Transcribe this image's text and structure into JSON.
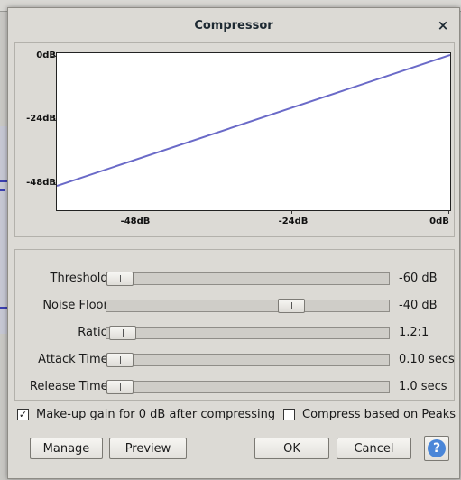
{
  "dialog": {
    "title": "Compressor",
    "close_glyph": "×"
  },
  "graph": {
    "y_labels": [
      "0dB",
      "-24dB",
      "-48dB"
    ],
    "x_labels": [
      "-48dB",
      "-24dB",
      "0dB"
    ],
    "curve_color": "#6a6ac8",
    "curve": [
      {
        "in_db": -60,
        "out_db": -48.3
      },
      {
        "in_db": 0,
        "out_db": 0
      }
    ]
  },
  "controls": [
    {
      "label": "Threshold:",
      "value": "-60 dB",
      "position": 0.0
    },
    {
      "label": "Noise Floor:",
      "value": "-40 dB",
      "position": 0.67
    },
    {
      "label": "Ratio:",
      "value": "1.2:1",
      "position": 0.01
    },
    {
      "label": "Attack Time:",
      "value": "0.10 secs",
      "position": 0.0
    },
    {
      "label": "Release Time:",
      "value": "1.0 secs",
      "position": 0.0
    }
  ],
  "options": {
    "makeup_label": "Make-up gain for 0 dB after compressing",
    "makeup_checked": "✓",
    "peaks_label": "Compress based on Peaks",
    "peaks_checked": ""
  },
  "buttons": {
    "manage": "Manage",
    "preview": "Preview",
    "ok": "OK",
    "cancel": "Cancel",
    "help": "?"
  }
}
